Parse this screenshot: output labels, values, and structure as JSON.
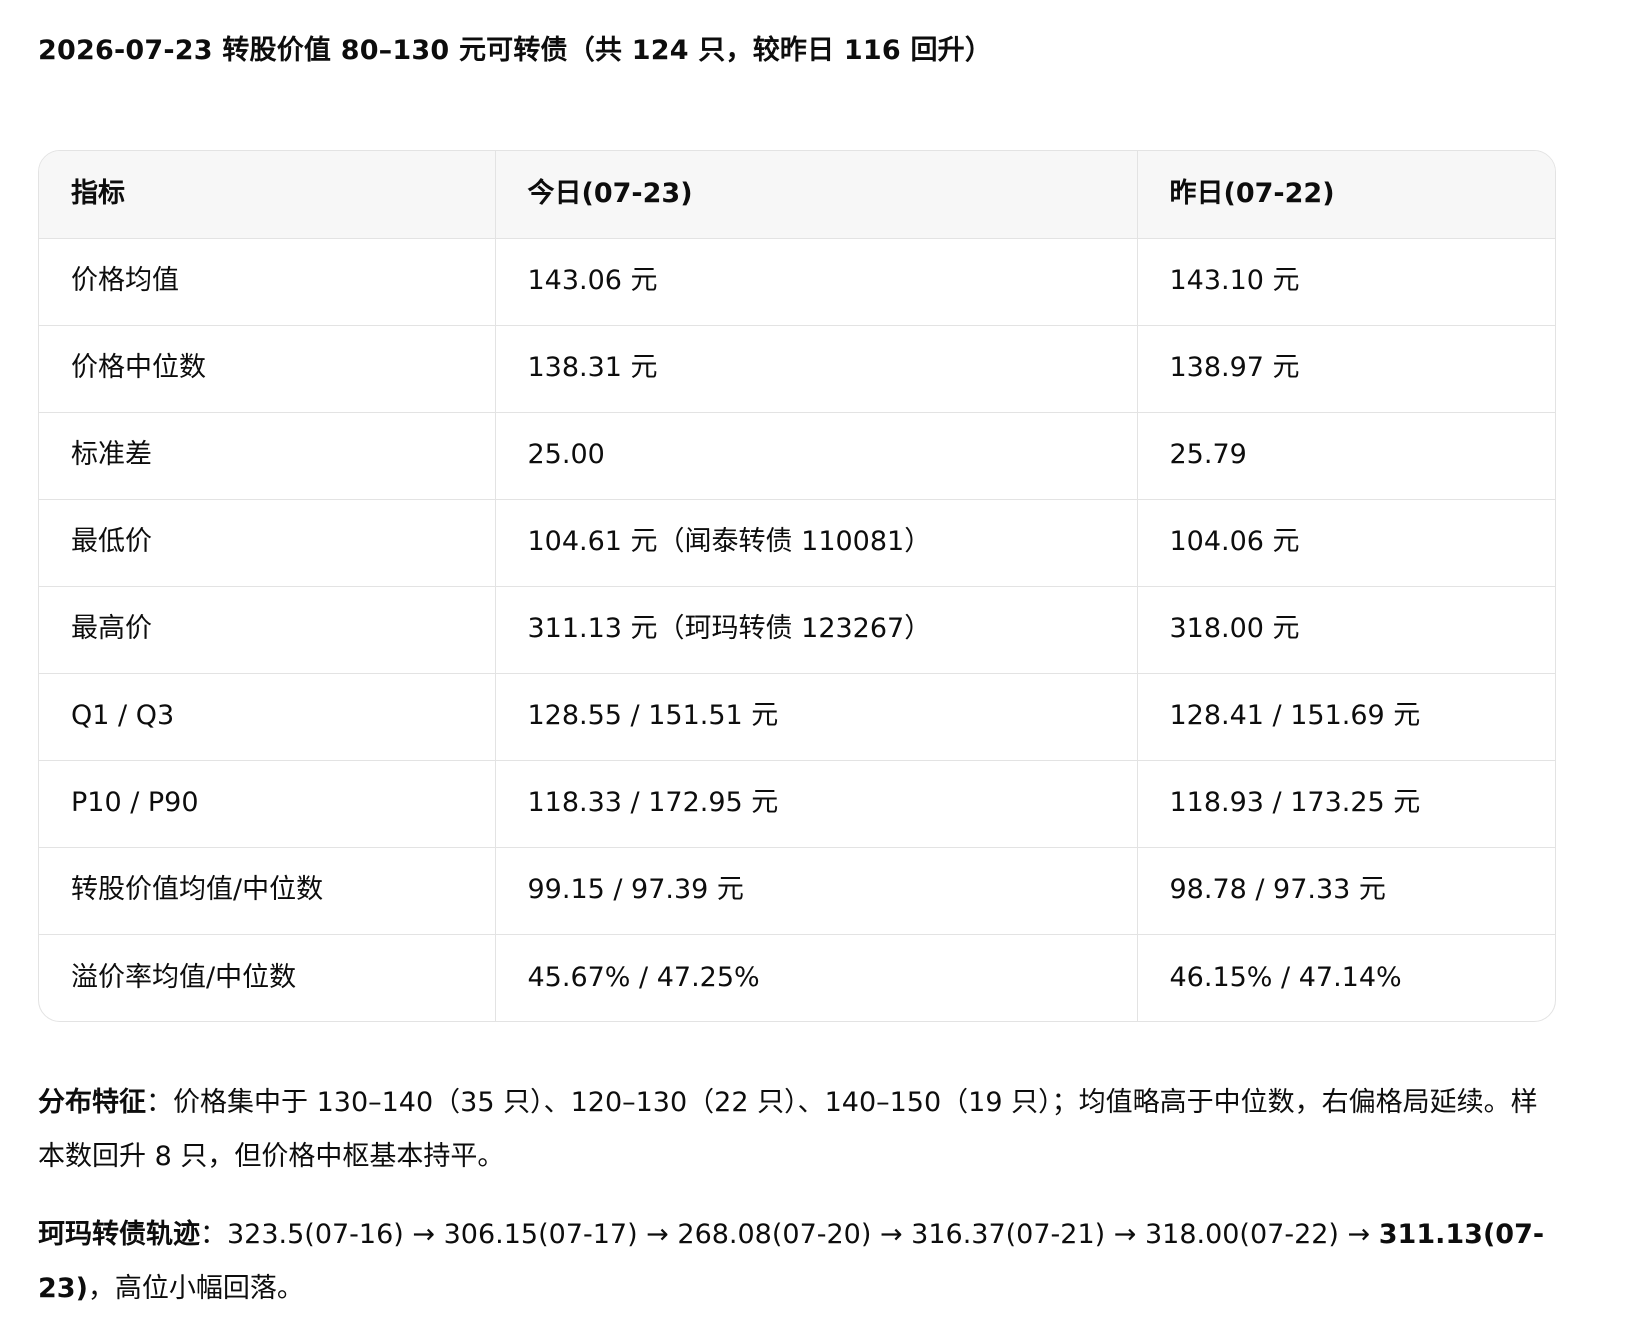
{
  "title": "2026-07-23 转股价值 80–130 元可转债（共 124 只，较昨日 116 回升）",
  "table": {
    "headers": [
      "指标",
      "今日(07-23)",
      "昨日(07-22)"
    ],
    "rows": [
      [
        "价格均值",
        "143.06 元",
        "143.10 元"
      ],
      [
        "价格中位数",
        "138.31 元",
        "138.97 元"
      ],
      [
        "标准差",
        "25.00",
        "25.79"
      ],
      [
        "最低价",
        "104.61 元（闻泰转债 110081）",
        "104.06 元"
      ],
      [
        "最高价",
        "311.13 元（珂玛转债 123267）",
        "318.00 元"
      ],
      [
        "Q1 / Q3",
        "128.55 / 151.51 元",
        "128.41 / 151.69 元"
      ],
      [
        "P10 / P90",
        "118.33 / 172.95 元",
        "118.93 / 173.25 元"
      ],
      [
        "转股价值均值/中位数",
        "99.15 / 97.39 元",
        "98.78 / 97.33 元"
      ],
      [
        "溢价率均值/中位数",
        "45.67% / 47.25%",
        "46.15% / 47.14%"
      ]
    ]
  },
  "distribution": {
    "label": "分布特征",
    "sep": "：",
    "text": "价格集中于 130–140（35 只）、120–130（22 只）、140–150（19 只）；均值略高于中位数，右偏格局延续。样本数回升 8 只，但价格中枢基本持平。"
  },
  "trajectory": {
    "label": "珂玛转债轨迹",
    "sep": "：",
    "text": "323.5(07-16) → 306.15(07-17) → 268.08(07-20) → 316.37(07-21) → 318.00(07-22) → ",
    "highlight": "311.13(07-23)",
    "tail": "，高位小幅回落。"
  }
}
